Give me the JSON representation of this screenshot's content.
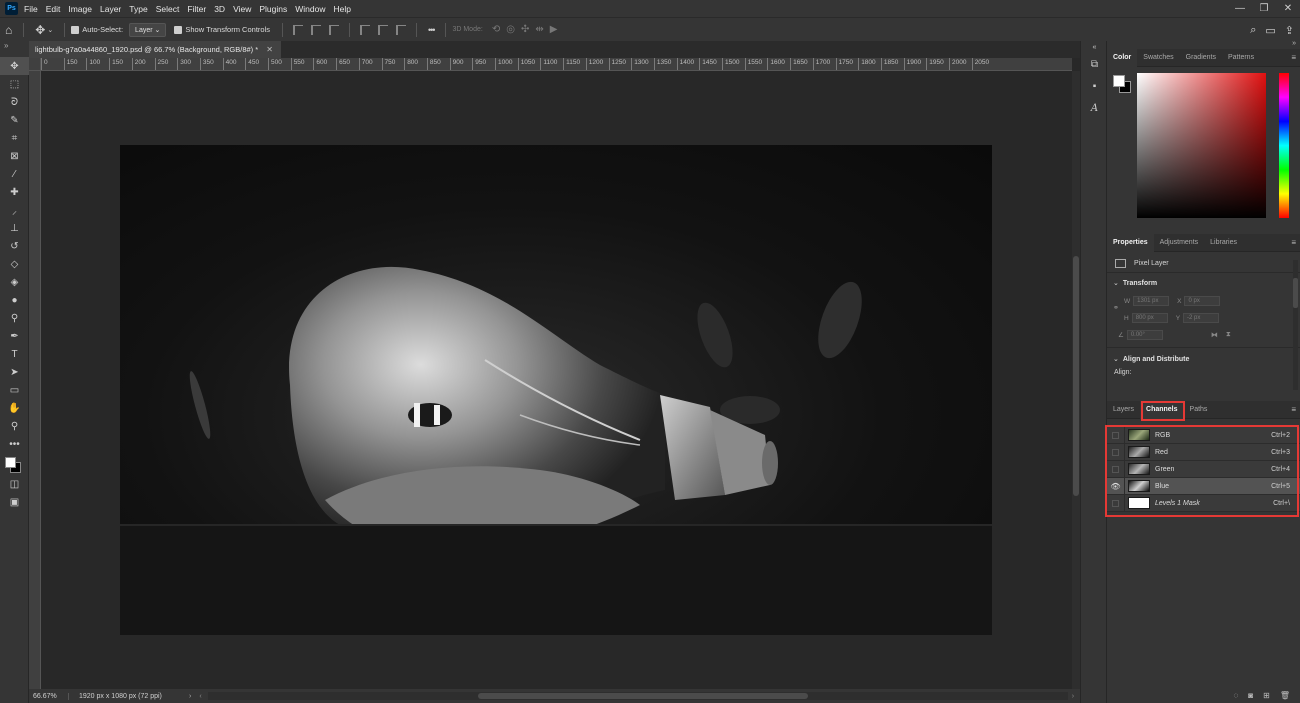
{
  "app": {
    "logo": "Ps"
  },
  "menu": [
    "File",
    "Edit",
    "Image",
    "Layer",
    "Type",
    "Select",
    "Filter",
    "3D",
    "View",
    "Plugins",
    "Window",
    "Help"
  ],
  "window_controls": {
    "minimize": "—",
    "maximize": "❐",
    "close": "✕"
  },
  "options": {
    "auto_select_label": "Auto-Select:",
    "auto_select_value": "Layer",
    "show_transform_label": "Show Transform Controls",
    "more": "•••",
    "mode_3d": "3D Mode:"
  },
  "document": {
    "tab_title": "lightbulb-g7a0a44860_1920.psd @ 66.7% (Background, RGB/8#) *",
    "zoom": "66.67%",
    "info": "1920 px x 1080 px (72 ppi)"
  },
  "ruler_labels": [
    "0",
    "150",
    "100",
    "150",
    "200",
    "250",
    "300",
    "350",
    "400",
    "450",
    "500",
    "550",
    "600",
    "650",
    "700",
    "750",
    "800",
    "850",
    "900",
    "950",
    "1000",
    "1050",
    "1100",
    "1150",
    "1200",
    "1250",
    "1300",
    "1350",
    "1400",
    "1450",
    "1500",
    "1550",
    "1600",
    "1650",
    "1700",
    "1750",
    "1800",
    "1850",
    "1900",
    "1950",
    "2000",
    "2050"
  ],
  "color_panel": {
    "tabs": [
      "Color",
      "Swatches",
      "Gradients",
      "Patterns"
    ],
    "active_tab": "Color",
    "foreground": "#ffffff",
    "background": "#000000"
  },
  "properties_panel": {
    "tabs": [
      "Properties",
      "Adjustments",
      "Libraries"
    ],
    "layer_type": "Pixel Layer",
    "transform_title": "Transform",
    "w": "1301 px",
    "h": "800 px",
    "x": "0 px",
    "y": "-2 px",
    "angle": "0.00°",
    "align_title": "Align and Distribute",
    "align_label": "Align:"
  },
  "channels_panel": {
    "tabs": [
      "Layers",
      "Channels",
      "Paths"
    ],
    "active_tab": "Channels",
    "channels": [
      {
        "name": "RGB",
        "shortcut": "Ctrl+2",
        "visible": false,
        "selected": false
      },
      {
        "name": "Red",
        "shortcut": "Ctrl+3",
        "visible": false,
        "selected": false
      },
      {
        "name": "Green",
        "shortcut": "Ctrl+4",
        "visible": false,
        "selected": false
      },
      {
        "name": "Blue",
        "shortcut": "Ctrl+5",
        "visible": true,
        "selected": true
      },
      {
        "name": "Levels 1 Mask",
        "shortcut": "Ctrl+\\",
        "visible": false,
        "selected": false
      }
    ],
    "highlight_color": "#e53935"
  }
}
